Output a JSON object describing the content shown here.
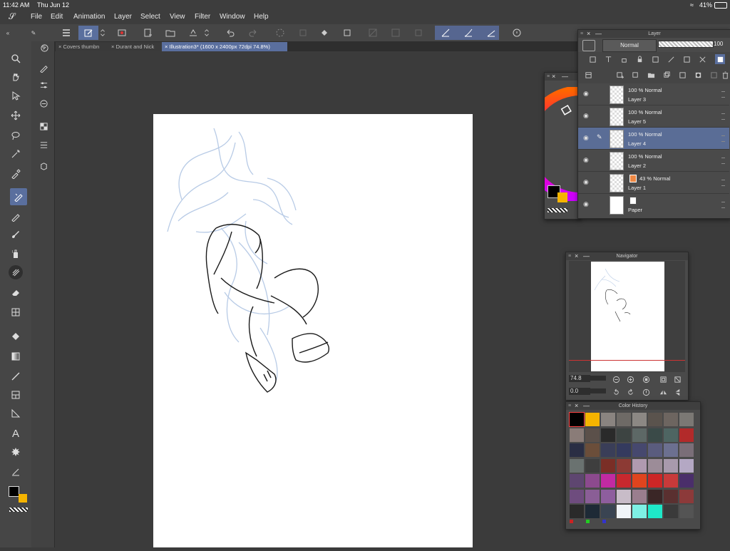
{
  "status": {
    "time": "11:42 AM",
    "date": "Thu Jun 12",
    "battery": "41%"
  },
  "menu": [
    "File",
    "Edit",
    "Animation",
    "Layer",
    "Select",
    "View",
    "Filter",
    "Window",
    "Help"
  ],
  "tabs": [
    {
      "label": "Covers thumbn",
      "active": false
    },
    {
      "label": "Durant and Nick",
      "active": false
    },
    {
      "label": "Illustration3* (1600 x 2400px 72dpi 74.8%)",
      "active": true
    }
  ],
  "layer_panel": {
    "title": "Layer",
    "blend_mode": "Normal",
    "opacity": "100",
    "layers": [
      {
        "opacity": "100 %",
        "mode": "Normal",
        "name": "Layer 3",
        "selected": false
      },
      {
        "opacity": "100 %",
        "mode": "Normal",
        "name": "Layer 5",
        "selected": false
      },
      {
        "opacity": "100 %",
        "mode": "Normal",
        "name": "Layer 4",
        "selected": true
      },
      {
        "opacity": "100 %",
        "mode": "Normal",
        "name": "Layer 2",
        "selected": false
      },
      {
        "opacity": "43 %",
        "mode": "Normal",
        "name": "Layer 1",
        "selected": false
      },
      {
        "opacity": "",
        "mode": "",
        "name": "Paper",
        "selected": false
      }
    ]
  },
  "navigator": {
    "title": "Navigator",
    "zoom": "74.8",
    "rotation": "0.0"
  },
  "color_history": {
    "title": "Color History",
    "colors": [
      "#000000",
      "#f5b400",
      "#8a8480",
      "#6e6a66",
      "#8c8884",
      "#5a534d",
      "#6d6560",
      "#7b7874",
      "#8a7c78",
      "#5b504a",
      "#2a2a2a",
      "#3d4442",
      "#5d6866",
      "#3a4a48",
      "#4e6562",
      "#b22a2a",
      "#2a2e44",
      "#6b4e3a",
      "#3a3e58",
      "#343a5e",
      "#46486e",
      "#5a5c7e",
      "#6c7090",
      "#7a6e78",
      "#6a7270",
      "#3e3e3e",
      "#7a2e26",
      "#8c3a34",
      "#b09ab0",
      "#9c8c98",
      "#a89aac",
      "#b4a8c4",
      "#5e4670",
      "#8c4a8e",
      "#c22aa2",
      "#c8282e",
      "#e0441e",
      "#cc2626",
      "#c83a3a",
      "#4a2e6a",
      "#6e4c7e",
      "#8a5e96",
      "#8e5e9e",
      "#c8bcc8",
      "#9a7e8e",
      "#3a2626",
      "#5a3030",
      "#8c3a3a",
      "#2a2a2a",
      "#1e2a36",
      "#3a4452",
      "#f0f4f8",
      "#7ef0e4",
      "#1ee8c8",
      "#3a3a3a",
      "#545454"
    ]
  },
  "colors": {
    "main": "#000000",
    "sub": "#f5b400",
    "accent": "#5a6f9e"
  }
}
